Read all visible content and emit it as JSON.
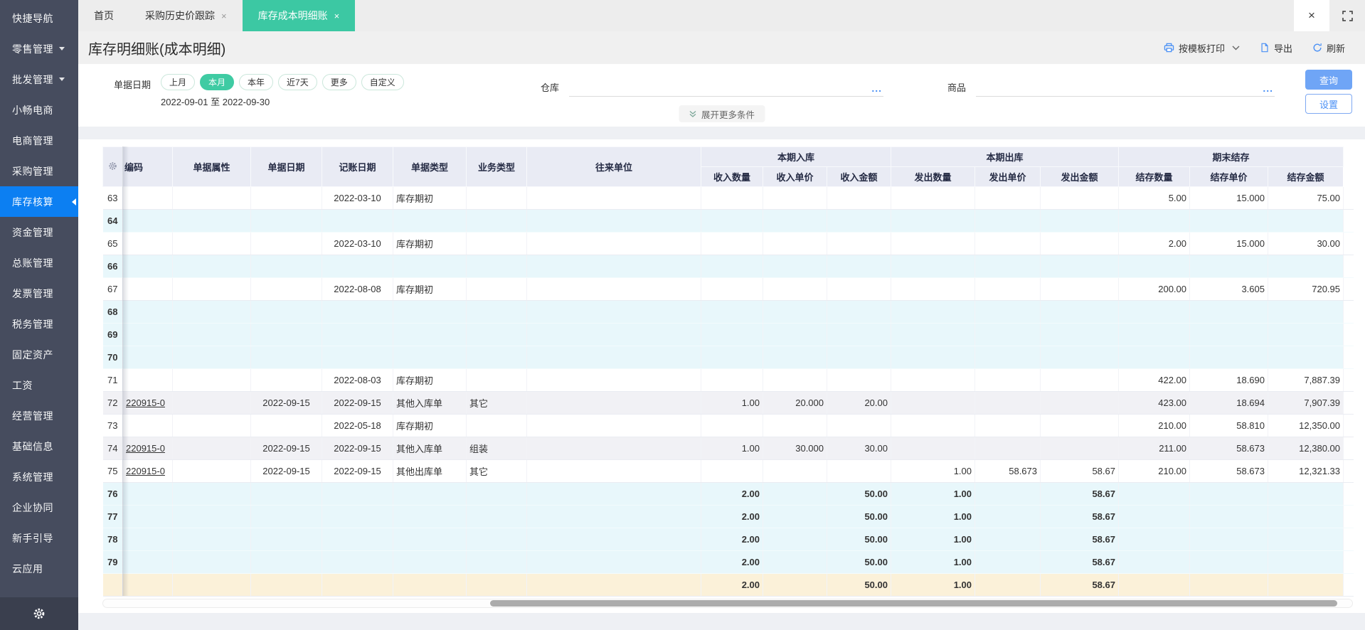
{
  "icons": {
    "close_glyph": "×",
    "ellipsis": "..."
  },
  "sidebar": {
    "items": [
      {
        "label": "快捷导航"
      },
      {
        "label": "零售管理",
        "caret": true
      },
      {
        "label": "批发管理",
        "caret": true
      },
      {
        "label": "小畅电商"
      },
      {
        "label": "电商管理"
      },
      {
        "label": "采购管理"
      },
      {
        "label": "库存核算",
        "active": true
      },
      {
        "label": "资金管理"
      },
      {
        "label": "总账管理"
      },
      {
        "label": "发票管理"
      },
      {
        "label": "税务管理"
      },
      {
        "label": "固定资产"
      },
      {
        "label": "工资"
      },
      {
        "label": "经营管理"
      },
      {
        "label": "基础信息"
      },
      {
        "label": "系统管理"
      },
      {
        "label": "企业协同"
      },
      {
        "label": "新手引导"
      },
      {
        "label": "云应用"
      }
    ]
  },
  "tabs": [
    {
      "label": "首页",
      "closable": false,
      "active": false
    },
    {
      "label": "采购历史价跟踪",
      "closable": true,
      "active": false
    },
    {
      "label": "库存成本明细账",
      "closable": true,
      "active": true
    }
  ],
  "page": {
    "title": "库存明细账(成本明细)"
  },
  "toolbar": {
    "print": "按模板打印",
    "export": "导出",
    "refresh": "刷新"
  },
  "filters": {
    "date_label": "单据日期",
    "date_pills": [
      "上月",
      "本月",
      "本年",
      "近7天",
      "更多",
      "自定义"
    ],
    "selected_pill": "本月",
    "date_range": "2022-09-01 至 2022-09-30",
    "warehouse_label": "仓库",
    "product_label": "商品",
    "expand_label": "展开更多条件",
    "query_label": "查询",
    "settings_label": "设置"
  },
  "table": {
    "header": {
      "code": "编码",
      "attr": "单据属性",
      "doc_date": "单据日期",
      "book_date": "记账日期",
      "doc_type": "单据类型",
      "biz_type": "业务类型",
      "partner": "往来单位",
      "group_in": "本期入库",
      "group_out": "本期出库",
      "group_end": "期末结存",
      "in_qty": "收入数量",
      "in_price": "收入单价",
      "in_amt": "收入金额",
      "out_qty": "发出数量",
      "out_price": "发出单价",
      "out_amt": "发出金额",
      "end_qty": "结存数量",
      "end_price": "结存单价",
      "end_amt": "结存金额"
    },
    "col_keys": [
      "no",
      "code",
      "attr",
      "doc_date",
      "book_date",
      "doc_type",
      "biz_type",
      "partner",
      "in_qty",
      "in_price",
      "in_amt",
      "out_qty",
      "out_price",
      "out_amt",
      "end_qty",
      "end_price",
      "end_amt"
    ],
    "rows": [
      {
        "no": "63",
        "book_date": "2022-03-10",
        "doc_type": "库存期初",
        "end_qty": "5.00",
        "end_price": "15.000",
        "end_amt": "75.00",
        "style": "white"
      },
      {
        "no": "64",
        "style": "blue"
      },
      {
        "no": "65",
        "book_date": "2022-03-10",
        "doc_type": "库存期初",
        "end_qty": "2.00",
        "end_price": "15.000",
        "end_amt": "30.00",
        "style": "white"
      },
      {
        "no": "66",
        "style": "blue"
      },
      {
        "no": "67",
        "book_date": "2022-08-08",
        "doc_type": "库存期初",
        "end_qty": "200.00",
        "end_price": "3.605",
        "end_amt": "720.95",
        "style": "white"
      },
      {
        "no": "68",
        "style": "blue"
      },
      {
        "no": "69",
        "style": "blue"
      },
      {
        "no": "70",
        "style": "blue"
      },
      {
        "no": "71",
        "book_date": "2022-08-03",
        "doc_type": "库存期初",
        "end_qty": "422.00",
        "end_price": "18.690",
        "end_amt": "7,887.39",
        "style": "white"
      },
      {
        "no": "72",
        "code": "220915-0",
        "doc_date": "2022-09-15",
        "book_date": "2022-09-15",
        "doc_type": "其他入库单",
        "biz_type": "其它",
        "in_qty": "1.00",
        "in_price": "20.000",
        "in_amt": "20.00",
        "end_qty": "423.00",
        "end_price": "18.694",
        "end_amt": "7,907.39",
        "style": "gray"
      },
      {
        "no": "73",
        "book_date": "2022-05-18",
        "doc_type": "库存期初",
        "end_qty": "210.00",
        "end_price": "58.810",
        "end_amt": "12,350.00",
        "style": "white"
      },
      {
        "no": "74",
        "code": "220915-0",
        "doc_date": "2022-09-15",
        "book_date": "2022-09-15",
        "doc_type": "其他入库单",
        "biz_type": "组装",
        "in_qty": "1.00",
        "in_price": "30.000",
        "in_amt": "30.00",
        "end_qty": "211.00",
        "end_price": "58.673",
        "end_amt": "12,380.00",
        "style": "gray"
      },
      {
        "no": "75",
        "code": "220915-0",
        "doc_date": "2022-09-15",
        "book_date": "2022-09-15",
        "doc_type": "其他出库单",
        "biz_type": "其它",
        "out_qty": "1.00",
        "out_price": "58.673",
        "out_amt": "58.67",
        "end_qty": "210.00",
        "end_price": "58.673",
        "end_amt": "12,321.33",
        "style": "white"
      },
      {
        "no": "76",
        "in_qty": "2.00",
        "in_amt": "50.00",
        "out_qty": "1.00",
        "out_amt": "58.67",
        "style": "blue"
      },
      {
        "no": "77",
        "in_qty": "2.00",
        "in_amt": "50.00",
        "out_qty": "1.00",
        "out_amt": "58.67",
        "style": "blue"
      },
      {
        "no": "78",
        "in_qty": "2.00",
        "in_amt": "50.00",
        "out_qty": "1.00",
        "out_amt": "58.67",
        "style": "blue"
      },
      {
        "no": "79",
        "in_qty": "2.00",
        "in_amt": "50.00",
        "out_qty": "1.00",
        "out_amt": "58.67",
        "style": "blue"
      },
      {
        "no": "",
        "in_qty": "2.00",
        "in_amt": "50.00",
        "out_qty": "1.00",
        "out_amt": "58.67",
        "style": "yellow"
      }
    ]
  }
}
